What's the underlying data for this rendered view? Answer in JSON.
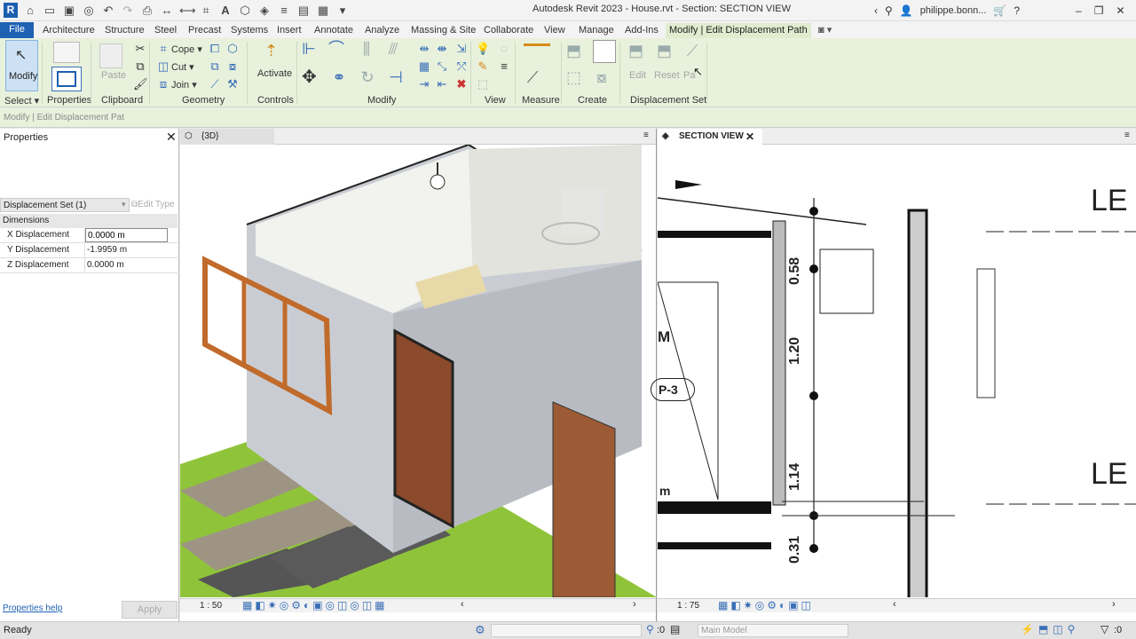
{
  "app": {
    "logo": "R",
    "title": "Autodesk Revit 2023 - House.rvt - Section: SECTION VIEW",
    "user": "philippe.bonn..."
  },
  "tabs": [
    "File",
    "Architecture",
    "Structure",
    "Steel",
    "Precast",
    "Systems",
    "Insert",
    "Annotate",
    "Analyze",
    "Massing & Site",
    "Collaborate",
    "View",
    "Manage",
    "Add-Ins",
    "Modify | Edit Displacement Path"
  ],
  "ribbon": {
    "modify": "Modify",
    "paste": "Paste",
    "cope": "Cope",
    "cut": "Cut",
    "join": "Join",
    "activate": "Activate",
    "edit": "Edit",
    "reset": "Reset",
    "path": "Pa",
    "panels": {
      "select": "Select",
      "properties": "Properties",
      "clipboard": "Clipboard",
      "geometry": "Geometry",
      "controls": "Controls",
      "modify": "Modify",
      "view": "View",
      "measure": "Measure",
      "create": "Create",
      "displacement_set": "Displacement Set"
    }
  },
  "optionsbar": {
    "text": "Modify | Edit Displacement Pat"
  },
  "properties": {
    "title": "Properties",
    "type_selector": "Displacement Set (1)",
    "edit_type": "Edit Type",
    "group": "Dimensions",
    "rows": [
      {
        "label": "X Displacement",
        "value": "0.0000 m"
      },
      {
        "label": "Y Displacement",
        "value": "-1.9959 m"
      },
      {
        "label": "Z Displacement",
        "value": "0.0000 m"
      }
    ],
    "help": "Properties help",
    "apply": "Apply"
  },
  "view3d": {
    "tab": "{3D}",
    "scale": "1 : 50"
  },
  "viewsec": {
    "tab": "SECTION VIEW",
    "scale": "1 : 75",
    "dims": [
      "0.58",
      "1.20",
      "1.14",
      "0.31"
    ],
    "labels": {
      "level1": "LE",
      "level2": "LE",
      "tag": "P-3",
      "m1": "M",
      "m2": "m"
    }
  },
  "statusbar": {
    "ready": "Ready",
    "zero": ":0",
    "model": "Main Model",
    "count": ":0"
  },
  "colors": {
    "file_tab": "#1f62b3",
    "ribbon_bg": "#e8f1dc",
    "floor_green": "#8fc43a",
    "door_wood": "#8b4a2b"
  }
}
